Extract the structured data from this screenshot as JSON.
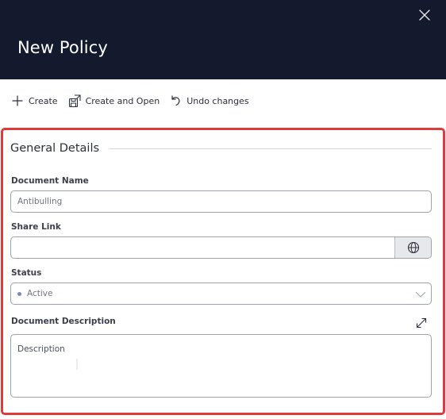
{
  "header": {
    "title": "New Policy",
    "close_icon": "close-icon"
  },
  "toolbar": {
    "create_label": "Create",
    "create_open_label": "Create and Open",
    "undo_label": "Undo changes"
  },
  "section": {
    "title": "General Details"
  },
  "form": {
    "document_name": {
      "label": "Document Name",
      "value": "Antibulling"
    },
    "share_link": {
      "label": "Share Link",
      "value": "",
      "button_icon": "globe-icon"
    },
    "status": {
      "label": "Status",
      "value": "Active",
      "dot_color": "#7f8ab0"
    },
    "description": {
      "label": "Document Description",
      "placeholder": "Description",
      "expand_icon": "expand-icon"
    }
  },
  "colors": {
    "header_bg": "#131a2e",
    "highlight_border": "#e03a3a",
    "input_border": "#9da2ad",
    "globe_button_bg": "#e6e8ec"
  }
}
